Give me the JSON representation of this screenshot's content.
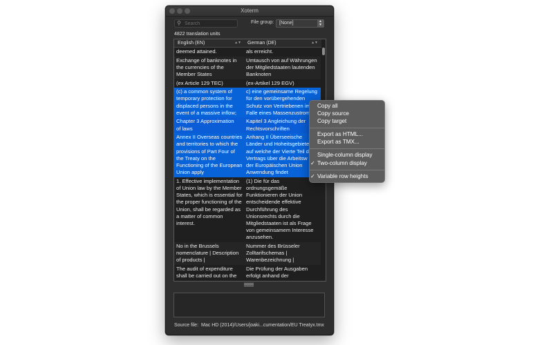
{
  "window": {
    "title": "Xoterm"
  },
  "search": {
    "placeholder": "Search"
  },
  "file_group": {
    "label": "File group:",
    "value": "[None]"
  },
  "unit_count": "4822 translation units",
  "table": {
    "headers": [
      "English (EN)",
      "German (DE)"
    ],
    "rows": [
      {
        "en": "deemed attained.",
        "de": "als erreicht."
      },
      {
        "en": "Exchange of banknotes in\nthe currencies of the\nMember States",
        "de": "Umtausch von auf Währungen\nder Mitgliedstaaten lautenden\nBanknoten"
      },
      {
        "en": "(ex Article 129 TEC)",
        "de": "(ex-Artikel 129 EGV)"
      },
      {
        "en": "(c) a common system of\ntemporary protection for\ndisplaced persons in the\nevent of a massive inflow;",
        "de": "c) eine gemeinsame Regelung\nfür den vorübergehenden\nSchutz von Vertriebenen im\nFalle eines Massenzustrom"
      },
      {
        "en": "Chapter 3 Approximation\nof laws",
        "de": "Kapitel 3 Angleichung der\nRechtsvorschriften"
      },
      {
        "en": "Annex II Overseas countries\nand territories to which the\nprovisions of Part Four of\nthe Treaty on the\nFunctioning of the European\nUnion apply",
        "de": "Anhang II Überseeische\nLänder und Hoheitsgebiete\nauf welche der Vierte Teil d\nVertrags über die Arbeitsw\nder Europäischen Union\nAnwendung findet"
      },
      {
        "en": "1. Effective implementation\nof Union law by the Member\nStates, which is essential for\nthe proper functioning of the\nUnion, shall be regarded as\na matter of common\ninterest.",
        "de": "(1) Die für das\nordnungsgemäße\nFunktionieren der Union\nentscheidende effektive\nDurchführung des\nUnionsrechts durch die\nMitgliedstaaten ist als Frage\nvon gemeinsamem Interesse\nanzusehen."
      },
      {
        "en": "No in the Brussels\nnomenclature | Description\nof products |",
        "de": "Nummer des Brüsseler\nZolltarifschemas |\nWarenbezeichnung |"
      },
      {
        "en": "The audit of expenditure\nshall be carried out on the",
        "de": "Die Prüfung der Ausgaben\nerfolgt anhand der"
      }
    ],
    "selected_rows": [
      3,
      4,
      5
    ]
  },
  "source_file": {
    "label": "Source file:",
    "path": "Mac HD (2014)/Users/joaki...cumentation/EU Treatyx.tmx"
  },
  "context_menu": {
    "items": [
      "Copy all",
      "Copy source",
      "Copy target",
      "Export as HTML...",
      "Export as TMX...",
      "Single-column display",
      "Two-column display",
      "Variable row heights"
    ],
    "checked": [
      "Two-column display",
      "Variable row heights"
    ]
  },
  "colors": {
    "selection": "#0a5dd6",
    "window_bg": "#2e2e2e",
    "menu_bg": "#5c5c5c"
  }
}
